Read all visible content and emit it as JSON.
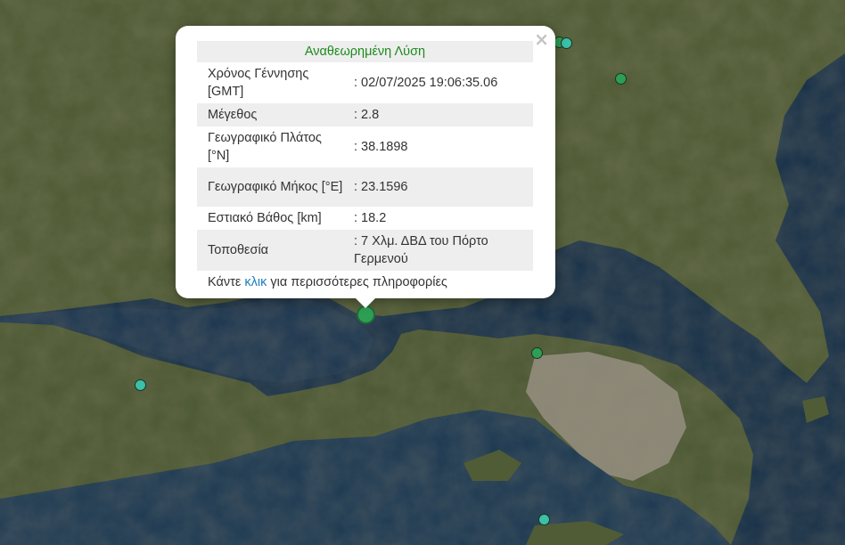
{
  "popup": {
    "title": "Αναθεωρημένη Λύση",
    "close_label": "×",
    "rows": [
      {
        "label": "Χρόνος Γέννησης [GMT]",
        "value": ": 02/07/2025 19:06:35.06"
      },
      {
        "label": "Μέγεθος",
        "value": ": 2.8"
      },
      {
        "label": "Γεωγραφικό Πλάτος [°N]",
        "value": ": 38.1898"
      },
      {
        "label": "Γεωγραφικό Μήκος [°E]",
        "value": ": 23.1596"
      },
      {
        "label": "Εστιακό Βάθος [km]",
        "value": ": 18.2"
      },
      {
        "label": "Τοποθεσία",
        "value": ": 7 Χλμ. ΔΒΔ του Πόρτο Γερμενού"
      }
    ],
    "more_prefix": "Κάντε",
    "more_link": "κλικ",
    "more_suffix": "για περισσότερες πληροφορίες"
  },
  "colors": {
    "sea": "#173048",
    "land": "#4d5a34",
    "marker_recent": "#2e9e55",
    "marker_old": "#3cc0a8",
    "popup_title": "#1c8a1c",
    "link": "#1a7fc1"
  }
}
